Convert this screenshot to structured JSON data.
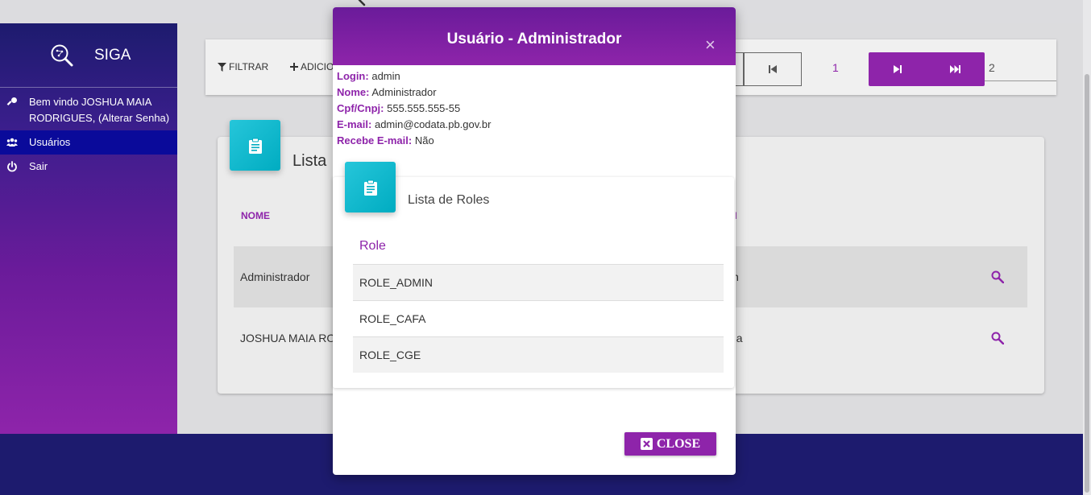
{
  "app": {
    "name": "SIGA"
  },
  "sidebar": {
    "items": [
      {
        "label": "Bem vindo JOSHUA MAIA RODRIGUES, (Alterar Senha)",
        "icon": "key-icon"
      },
      {
        "label": "Usuários",
        "icon": "users-icon",
        "active": true
      },
      {
        "label": "Sair",
        "icon": "power-icon"
      }
    ]
  },
  "toolbar": {
    "filter_label": "FILTRAR",
    "add_label": "ADICIO",
    "pagination": {
      "page_1": "1",
      "page_2": "2"
    }
  },
  "list": {
    "title": "Lista",
    "columns": {
      "name": "NOME",
      "login_partial": "N"
    },
    "rows": [
      {
        "name": "Administrador",
        "login_partial": "in"
      },
      {
        "name": "JOSHUA MAIA RO",
        "login_partial": "ua"
      }
    ]
  },
  "modal": {
    "title": "Usuário - Administrador",
    "close_x": "×",
    "fields": [
      {
        "label": "Login:",
        "value": "admin"
      },
      {
        "label": "Nome:",
        "value": "Administrador"
      },
      {
        "label": "Cpf/Cnpj:",
        "value": "555.555.555-55"
      },
      {
        "label": "E-mail:",
        "value": "admin@codata.pb.gov.br"
      },
      {
        "label": "Recebe E-mail:",
        "value": "Não"
      }
    ],
    "roles": {
      "title": "Lista de Roles",
      "column": "Role",
      "items": [
        "ROLE_ADMIN",
        "ROLE_CAFA",
        "ROLE_CGE"
      ]
    },
    "close_label": "CLOSE"
  },
  "colors": {
    "accent": "#8e24aa",
    "sidebar_top": "#1d1b6e",
    "sidebar_active": "#0a0a9a",
    "card_icon": "#00bcd4",
    "footer": "#1d1b6e"
  }
}
